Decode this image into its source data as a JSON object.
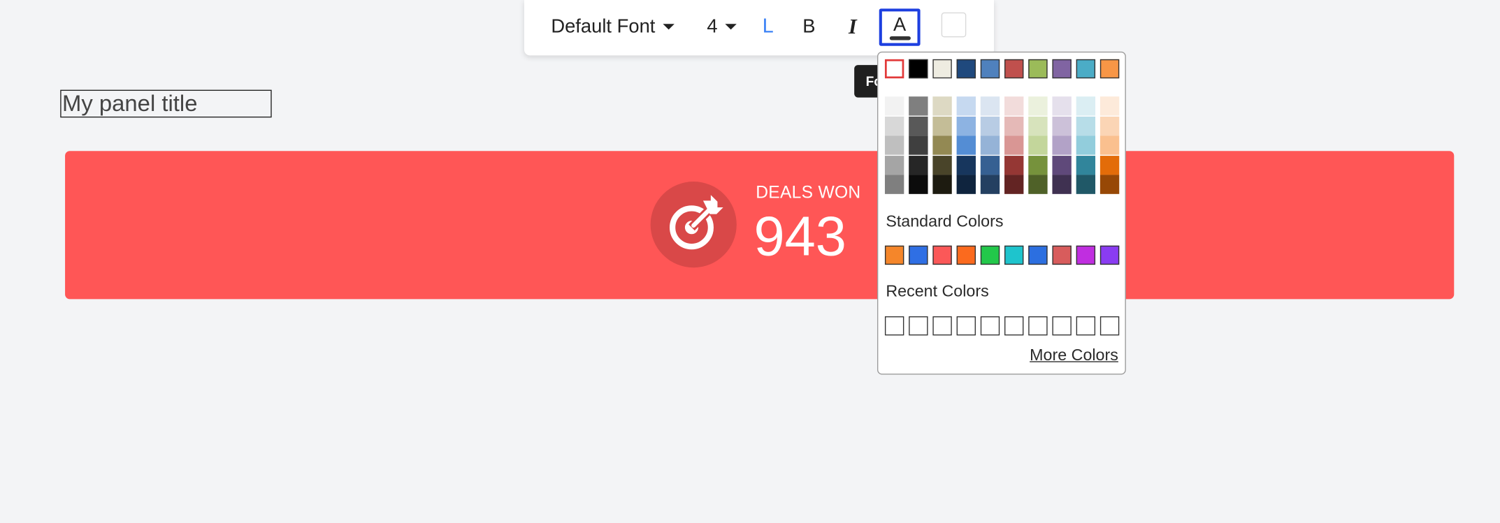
{
  "toolbar": {
    "font_label": "Default Font",
    "size_label": "4",
    "align_label": "L",
    "bold_label": "B",
    "italic_label": "I",
    "color_label": "A",
    "tooltip_text": "Fo"
  },
  "panel": {
    "title": "My panel title"
  },
  "kpi": {
    "label": "DEALS WON",
    "value": "943",
    "icon": "target-icon",
    "color": "#ff5656"
  },
  "picker": {
    "top_colors": [
      "#ffffff",
      "#000000",
      "#eeece1",
      "#1f497d",
      "#4f81bd",
      "#c0504d",
      "#9bbb59",
      "#8064a2",
      "#4bacc6",
      "#f79646"
    ],
    "tint_columns": [
      [
        "#f2f2f2",
        "#d8d8d8",
        "#bfbfbf",
        "#a5a5a5",
        "#7f7f7f"
      ],
      [
        "#7f7f7f",
        "#595959",
        "#3f3f3f",
        "#262626",
        "#0c0c0c"
      ],
      [
        "#ddd9c3",
        "#c4bd97",
        "#938953",
        "#494429",
        "#1d1b10"
      ],
      [
        "#c6d9f0",
        "#8db3e2",
        "#548dd4",
        "#17365d",
        "#0f243e"
      ],
      [
        "#dbe5f1",
        "#b8cce4",
        "#95b3d7",
        "#366092",
        "#244061"
      ],
      [
        "#f2dcdb",
        "#e5b9b7",
        "#d99694",
        "#953734",
        "#632423"
      ],
      [
        "#ebf1dd",
        "#d7e3bc",
        "#c3d69b",
        "#76923c",
        "#4f6128"
      ],
      [
        "#e5e0ec",
        "#ccc1d9",
        "#b2a2c7",
        "#5f497a",
        "#3f3151"
      ],
      [
        "#dbeef3",
        "#b7dde8",
        "#92cddc",
        "#31859b",
        "#205867"
      ],
      [
        "#fdeada",
        "#fbd5b5",
        "#fac08f",
        "#e36c09",
        "#974806"
      ]
    ],
    "standard_heading": "Standard Colors",
    "standard_colors": [
      "#f5862a",
      "#2f6fe4",
      "#fb5858",
      "#fb6a1e",
      "#22c84a",
      "#1ec4cd",
      "#2c6fe0",
      "#d85c5c",
      "#c02ee0",
      "#8a3cf2"
    ],
    "recent_heading": "Recent Colors",
    "recent_count": 10,
    "more_label": "More Colors"
  }
}
